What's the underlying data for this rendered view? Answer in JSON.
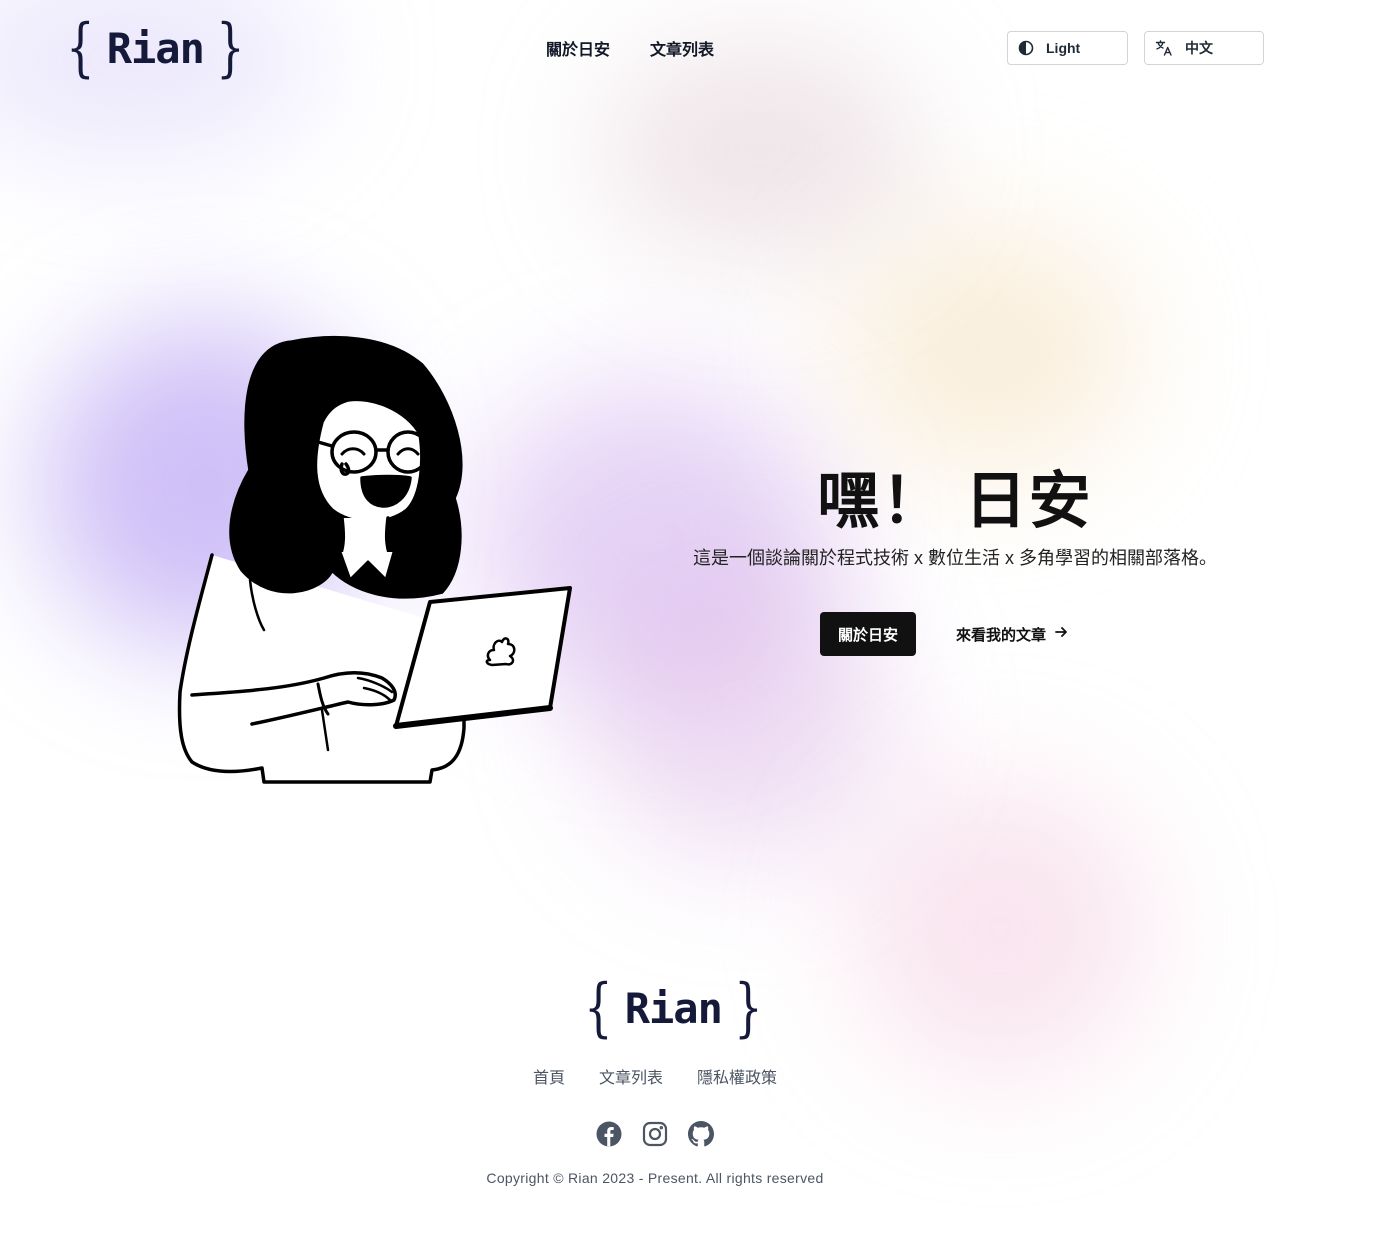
{
  "header": {
    "logo_text": "Rian",
    "nav": [
      {
        "label": "關於日安"
      },
      {
        "label": "文章列表"
      }
    ],
    "theme_toggle": {
      "label": "Light",
      "icon": "contrast-icon"
    },
    "language_select": {
      "label": "中文",
      "icon": "translate-icon"
    }
  },
  "hero": {
    "title": "嘿！ 日安",
    "description": "這是一個談論關於程式技術 x 數位生活 x 多角學習的相關部落格。",
    "primary_button": "關於日安",
    "secondary_link": "來看我的文章",
    "illustration": "girl-with-laptop-illustration"
  },
  "footer": {
    "logo_text": "Rian",
    "nav": [
      {
        "label": "首頁"
      },
      {
        "label": "文章列表"
      },
      {
        "label": "隱私權政策"
      }
    ],
    "socials": [
      "facebook-icon",
      "instagram-icon",
      "github-icon"
    ],
    "copyright": "Copyright © Rian 2023 - Present. All rights reserved"
  }
}
